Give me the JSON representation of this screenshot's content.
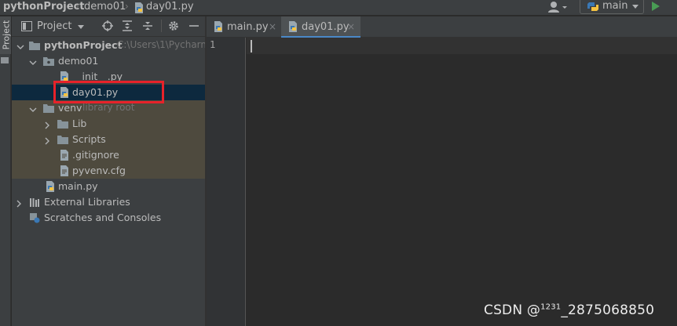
{
  "navbar": {
    "crumbs": [
      "pythonProject",
      "demo01",
      "day01.py"
    ],
    "run_config": "main",
    "icons": [
      "user-icon",
      "python-icon",
      "chevron-down-icon",
      "run-icon"
    ]
  },
  "side_strip": {
    "tab_label": "Project"
  },
  "project_panel": {
    "title": "Project",
    "toolbar_icons": [
      "target-icon",
      "expand-all-icon",
      "collapse-all-icon",
      "gear-icon",
      "minimize-icon"
    ],
    "tree": [
      {
        "label": "pythonProject",
        "hint": "C:\\Users\\1\\Pycharm",
        "icon": "folder-icon"
      },
      {
        "label": "demo01",
        "icon": "folder-icon"
      },
      {
        "label": "__init__.py",
        "icon": "python-file-icon"
      },
      {
        "label": "day01.py",
        "icon": "python-file-icon",
        "selected": true
      },
      {
        "label": "venv",
        "hint": "library root",
        "icon": "folder-icon"
      },
      {
        "label": "Lib",
        "icon": "folder-icon"
      },
      {
        "label": "Scripts",
        "icon": "folder-icon"
      },
      {
        "label": ".gitignore",
        "icon": "text-file-icon"
      },
      {
        "label": "pyvenv.cfg",
        "icon": "text-file-icon"
      },
      {
        "label": "main.py",
        "icon": "python-file-icon"
      },
      {
        "label": "External Libraries",
        "icon": "library-icon"
      },
      {
        "label": "Scratches and Consoles",
        "icon": "scratch-icon"
      }
    ]
  },
  "editor": {
    "tabs": [
      {
        "label": "main.py",
        "close": "×"
      },
      {
        "label": "day01.py",
        "close": "×",
        "active": true
      }
    ],
    "line_numbers": [
      "1"
    ]
  },
  "watermark": {
    "prefix": "CSDN @",
    "sup": "1231",
    "suffix": "_2875068850"
  },
  "colors": {
    "accent": "#4a88c7",
    "highlight_box": "#e6222a",
    "run_green": "#499c54",
    "selection": "#0d293e"
  }
}
